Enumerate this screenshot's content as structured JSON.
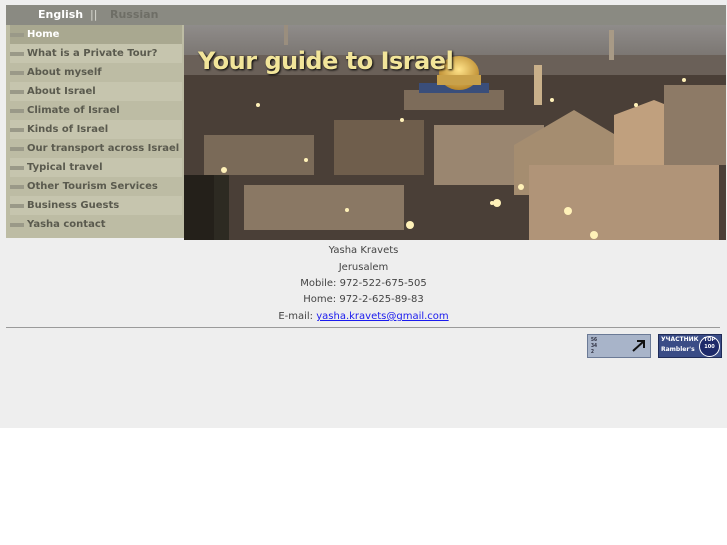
{
  "languages": {
    "english": "English",
    "separator": "||",
    "russian": "Russian"
  },
  "menu": [
    {
      "label": "Home",
      "active": true
    },
    {
      "label": "What is a Private Tour?"
    },
    {
      "label": "About myself"
    },
    {
      "label": "About Israel"
    },
    {
      "label": "Climate of Israel"
    },
    {
      "label": "Kinds of Israel"
    },
    {
      "label": "Our transport across Israel"
    },
    {
      "label": "Typical travel"
    },
    {
      "label": "Other Tourism Services"
    },
    {
      "label": "Business Guests"
    },
    {
      "label": "Yasha contact"
    }
  ],
  "hero": {
    "title": "Your guide to Israel"
  },
  "contact": {
    "name": "Yasha Kravets",
    "city": "Jerusalem",
    "mobile": "Mobile: 972-522-675-505",
    "home": "Home: 972-2-625-89-83",
    "email_prefix": "E-mail: ",
    "email": "yasha.kravets@gmail.com"
  },
  "counters": {
    "c1_digits": "56\n34\n2",
    "c2_top": "УЧАСТНИК",
    "c2_bottom": "Rambler's",
    "c2_badge": "TOP 100"
  },
  "colors": {
    "sidebar": "#bdbca4",
    "topbar": "#8a8a82",
    "title": "#f2e59a"
  }
}
